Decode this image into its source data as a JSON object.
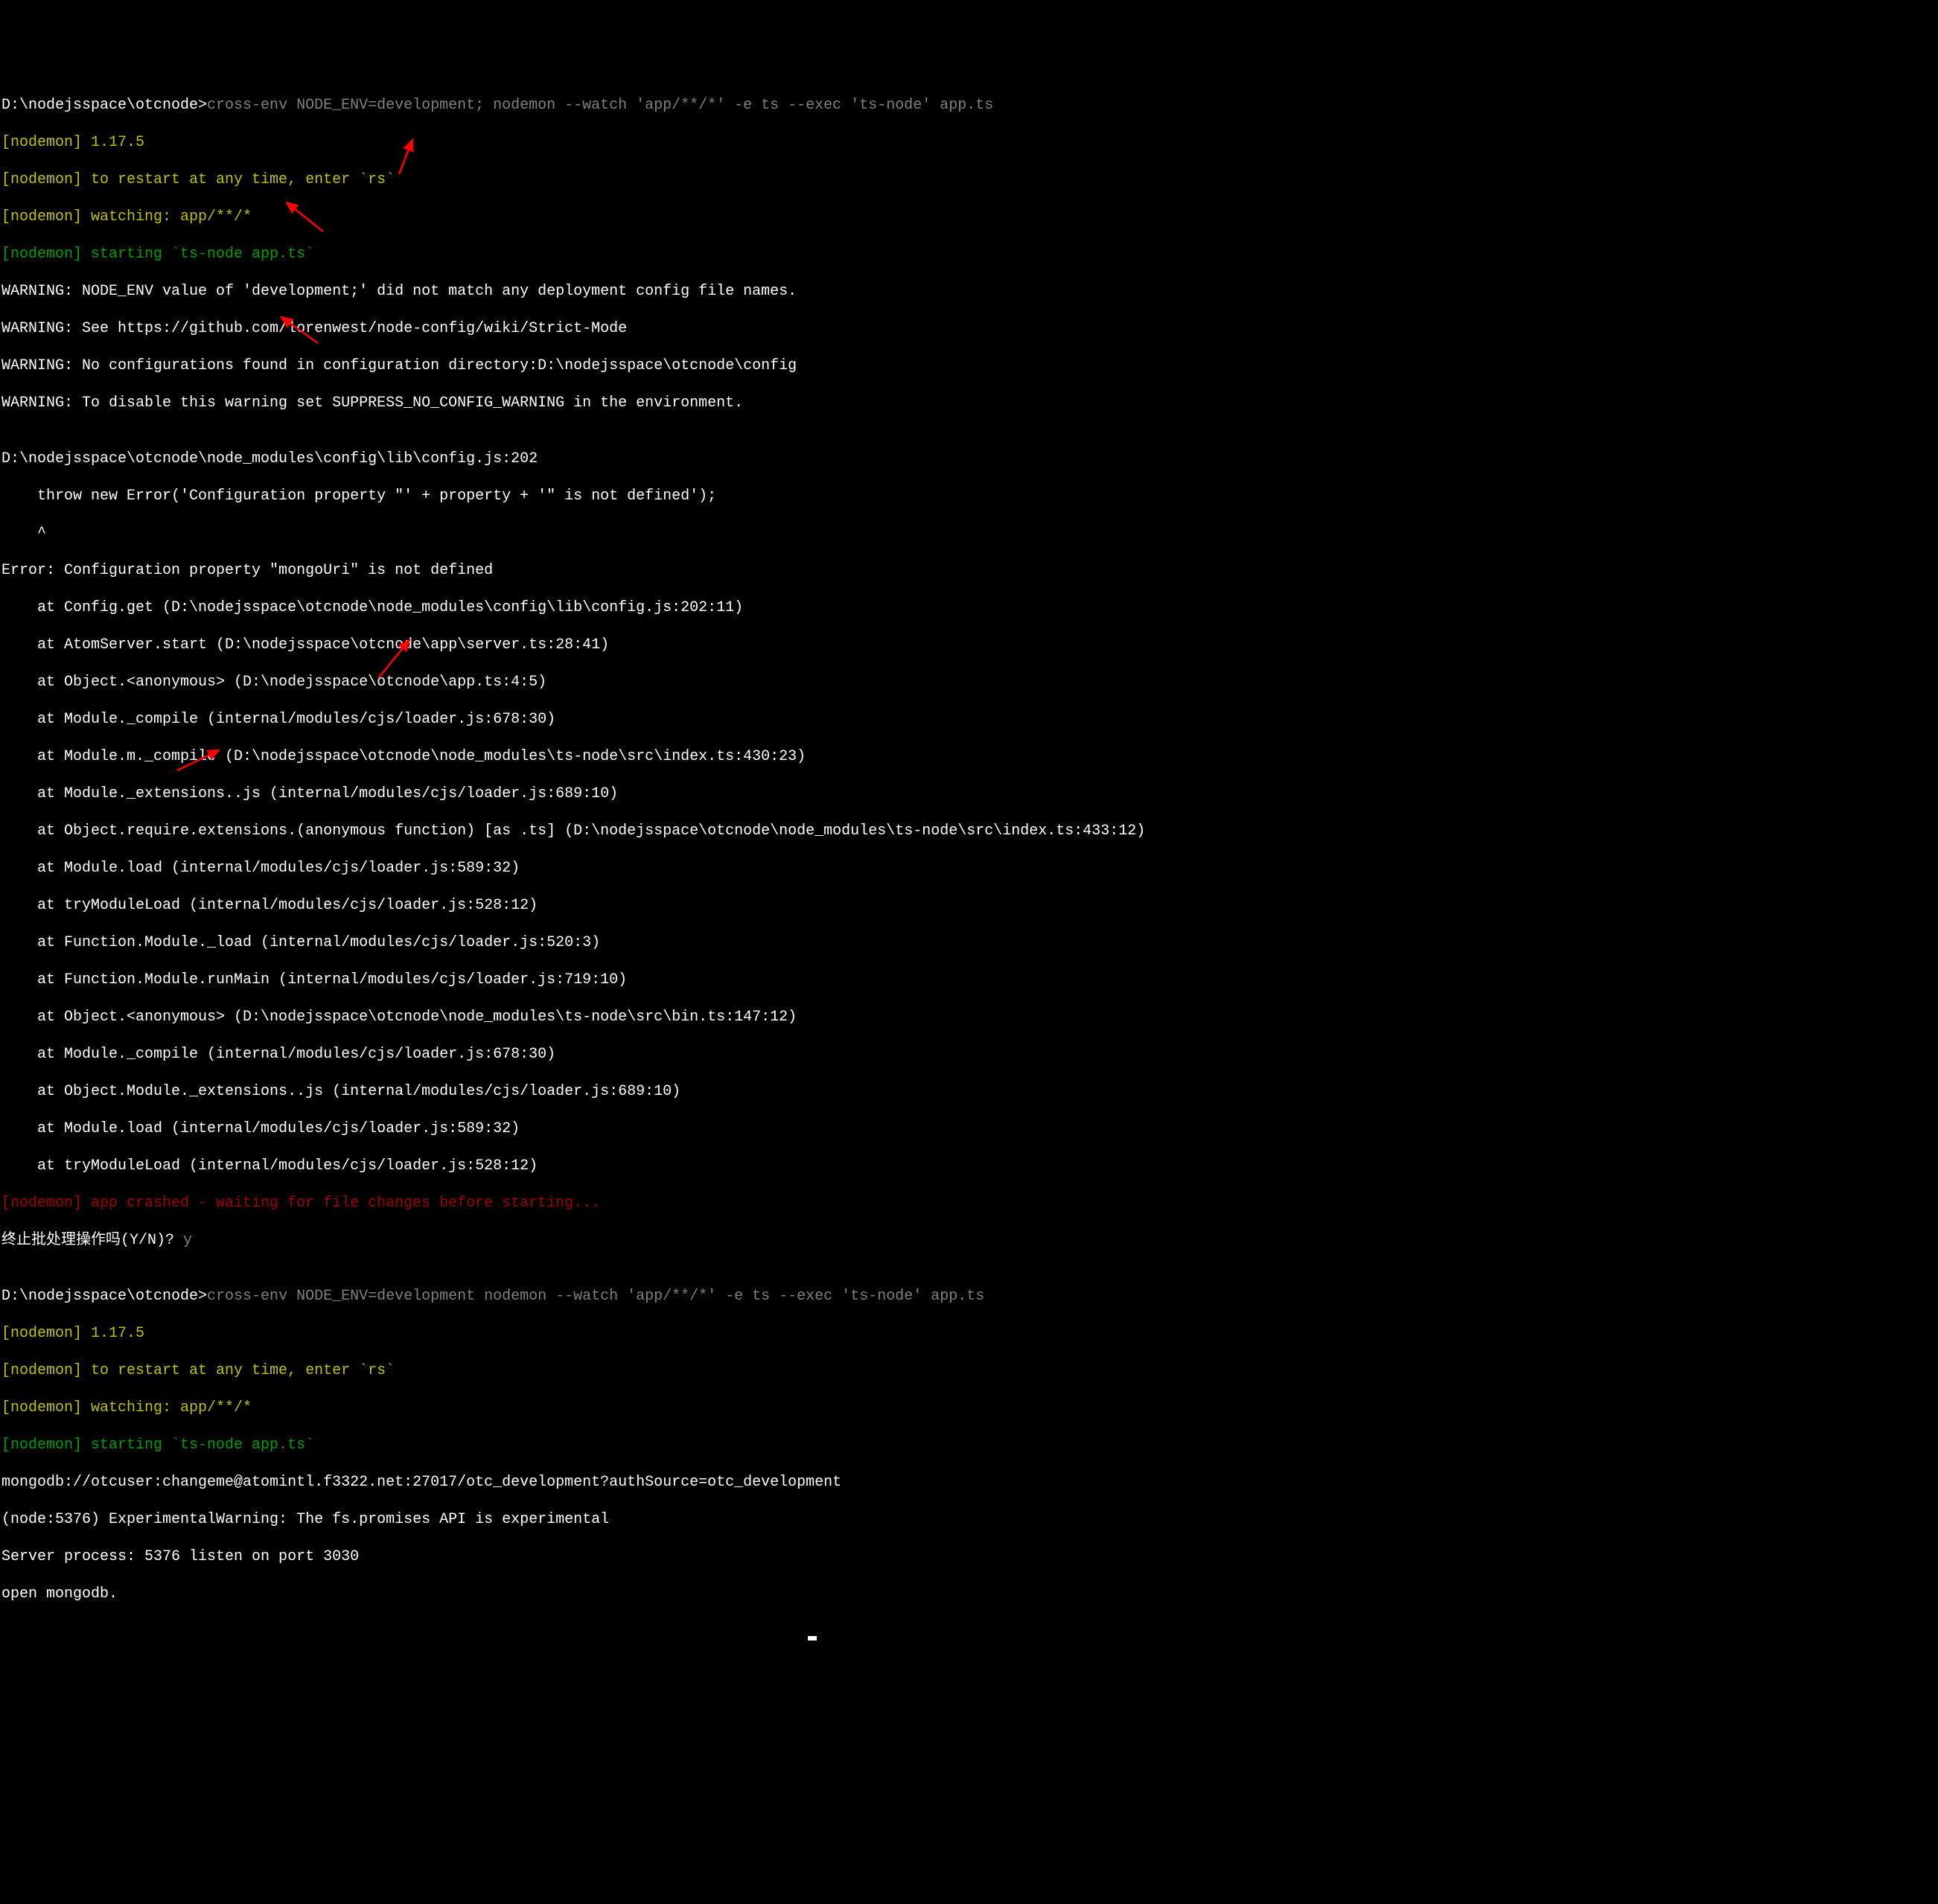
{
  "line01_prompt": "D:\\nodejsspace\\otcnode>",
  "line01_cmd": "cross-env NODE_ENV=development; nodemon --watch 'app/**/*' -e ts --exec 'ts-node' app.ts",
  "line02": "[nodemon] 1.17.5",
  "line03": "[nodemon] to restart at any time, enter `rs`",
  "line04": "[nodemon] watching: app/**/*",
  "line05": "[nodemon] starting `ts-node app.ts`",
  "line06": "WARNING: NODE_ENV value of 'development;' did not match any deployment config file names.",
  "line07": "WARNING: See https://github.com/lorenwest/node-config/wiki/Strict-Mode",
  "line08": "WARNING: No configurations found in configuration directory:D:\\nodejsspace\\otcnode\\config",
  "line09": "WARNING: To disable this warning set SUPPRESS_NO_CONFIG_WARNING in the environment.",
  "line10": "",
  "line11": "D:\\nodejsspace\\otcnode\\node_modules\\config\\lib\\config.js:202",
  "line12": "    throw new Error('Configuration property \"' + property + '\" is not defined');",
  "line13": "    ^",
  "line14": "Error: Configuration property \"mongoUri\" is not defined",
  "line15": "    at Config.get (D:\\nodejsspace\\otcnode\\node_modules\\config\\lib\\config.js:202:11)",
  "line16": "    at AtomServer.start (D:\\nodejsspace\\otcnode\\app\\server.ts:28:41)",
  "line17": "    at Object.<anonymous> (D:\\nodejsspace\\otcnode\\app.ts:4:5)",
  "line18": "    at Module._compile (internal/modules/cjs/loader.js:678:30)",
  "line19": "    at Module.m._compile (D:\\nodejsspace\\otcnode\\node_modules\\ts-node\\src\\index.ts:430:23)",
  "line20": "    at Module._extensions..js (internal/modules/cjs/loader.js:689:10)",
  "line21": "    at Object.require.extensions.(anonymous function) [as .ts] (D:\\nodejsspace\\otcnode\\node_modules\\ts-node\\src\\index.ts:433:12)",
  "line22": "    at Module.load (internal/modules/cjs/loader.js:589:32)",
  "line23": "    at tryModuleLoad (internal/modules/cjs/loader.js:528:12)",
  "line24": "    at Function.Module._load (internal/modules/cjs/loader.js:520:3)",
  "line25": "    at Function.Module.runMain (internal/modules/cjs/loader.js:719:10)",
  "line26": "    at Object.<anonymous> (D:\\nodejsspace\\otcnode\\node_modules\\ts-node\\src\\bin.ts:147:12)",
  "line27": "    at Module._compile (internal/modules/cjs/loader.js:678:30)",
  "line28": "    at Object.Module._extensions..js (internal/modules/cjs/loader.js:689:10)",
  "line29": "    at Module.load (internal/modules/cjs/loader.js:589:32)",
  "line30": "    at tryModuleLoad (internal/modules/cjs/loader.js:528:12)",
  "line31": "[nodemon] app crashed - waiting for file changes before starting...",
  "line32_q": "终止批处理操作吗(Y/N)? ",
  "line32_a": "y",
  "line33": "",
  "line34_prompt": "D:\\nodejsspace\\otcnode>",
  "line34_cmd": "cross-env NODE_ENV=development nodemon --watch 'app/**/*' -e ts --exec 'ts-node' app.ts",
  "line35": "[nodemon] 1.17.5",
  "line36": "[nodemon] to restart at any time, enter `rs`",
  "line37": "[nodemon] watching: app/**/*",
  "line38": "[nodemon] starting `ts-node app.ts`",
  "line39": "mongodb://otcuser:changeme@atomintl.f3322.net:27017/otc_development?authSource=otc_development",
  "line40": "(node:5376) ExperimentalWarning: The fs.promises API is experimental",
  "line41": "Server process: 5376 listen on port 3030",
  "line42": "open mongodb.",
  "colors": {
    "bg": "#000000",
    "fg": "#ffffff",
    "yellow": "#c0c000",
    "green": "#00a000",
    "red": "#a00000",
    "gray": "#808080",
    "arrow": "#ff0000"
  }
}
